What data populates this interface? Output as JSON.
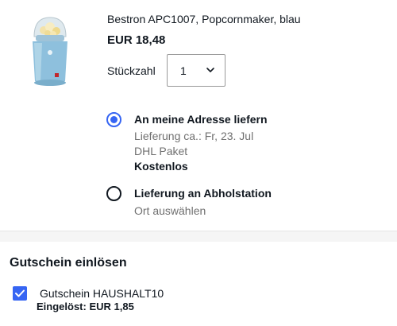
{
  "product": {
    "title": "Bestron APC1007, Popcornmaker, blau",
    "price": "EUR 18,48",
    "image_icon": "popcorn-maker-image"
  },
  "quantity": {
    "label": "Stückzahl",
    "value": "1"
  },
  "delivery": {
    "home": {
      "title": "An meine Adresse liefern",
      "eta": "Lieferung ca.: Fr, 23. Jul",
      "carrier": "DHL Paket",
      "cost": "Kostenlos",
      "selected": true
    },
    "pickup": {
      "title": "Lieferung an Abholstation",
      "sub": "Ort auswählen",
      "selected": false
    }
  },
  "coupon": {
    "section_title": "Gutschein einlösen",
    "label": "Gutschein HAUSHALT10",
    "redeemed": "Eingelöst: EUR 1,85",
    "checked": true
  },
  "colors": {
    "accent": "#3665f3",
    "muted_text": "#707070",
    "text": "#111820"
  }
}
